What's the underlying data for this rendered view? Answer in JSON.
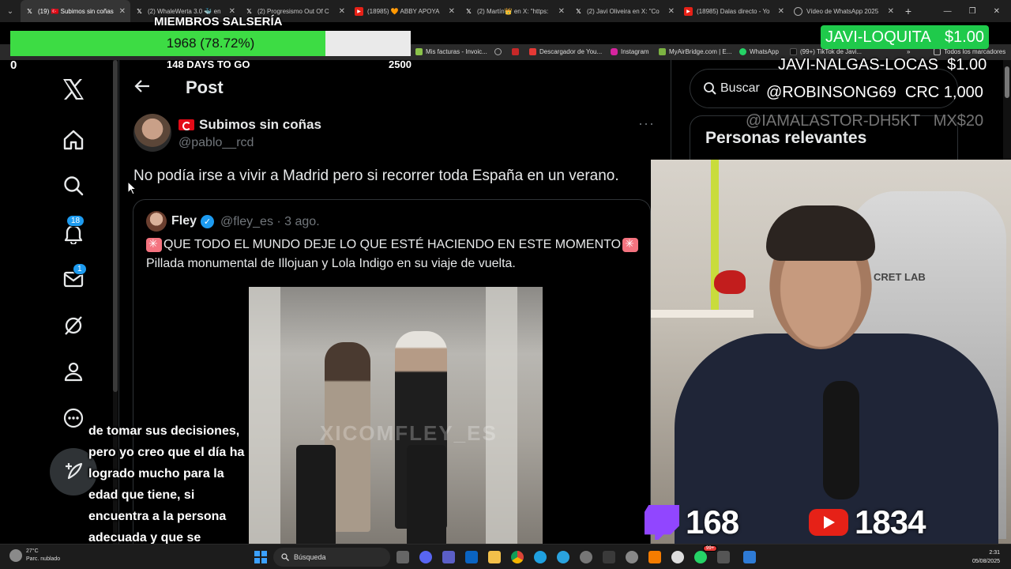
{
  "browser": {
    "tabs": [
      {
        "title": "(19) 🇹🇷 Subimos sin coñas",
        "icon": "x-logo-icon",
        "active": true
      },
      {
        "title": "(2) WhaleWerta 3.0 🐳 en",
        "icon": "x-logo-icon",
        "active": false
      },
      {
        "title": "(2) Progresismo Out Of C",
        "icon": "x-logo-icon",
        "active": false
      },
      {
        "title": "(18985) 🧡 ABBY APOYA",
        "icon": "youtube-icon",
        "active": false
      },
      {
        "title": "(2) Martín👑 en X: \"https:",
        "icon": "x-logo-icon",
        "active": false
      },
      {
        "title": "(2) Javi Oliveira en X: \"Co",
        "icon": "x-logo-icon",
        "active": false
      },
      {
        "title": "(18985) Dalas directo - Yo",
        "icon": "youtube-icon",
        "active": false
      },
      {
        "title": "Vídeo de WhatsApp 2025",
        "icon": "globe-icon",
        "active": false
      }
    ],
    "bookmarks": [
      "Mis facturas - Invoic...",
      "Descargador de You...",
      "Instagram",
      "MyAirBridge.com | E...",
      "WhatsApp",
      "(99+) TikTok de Javi..."
    ],
    "all_bookmarks": "Todos los marcadores"
  },
  "nav": {
    "notifications_badge": "18",
    "messages_badge": "1"
  },
  "post": {
    "header_title": "Post",
    "author_name": "Subimos sin coñas",
    "author_handle": "@pablo__rcd",
    "more": "···",
    "text": "No podía irse a vivir a Madrid pero si recorrer toda España en un verano.",
    "quote": {
      "name": "Fley",
      "handle_time": "@fley_es · 3 ago.",
      "line1": "QUE TODO EL MUNDO DEJE LO QUE ESTÉ HACIENDO EN ESTE MOMENTO",
      "line2": "Pillada monumental de Illojuan y Lola Indigo en su viaje de vuelta.",
      "video_watermark": "XICOMFLEY_ES"
    }
  },
  "sidebar": {
    "search_placeholder": "Buscar",
    "relevant_title": "Personas relevantes"
  },
  "overlay": {
    "goal_title": "MIEMBROS SALSERÍA",
    "goal_value": "1968 (78.72%)",
    "goal_fraction": 0.7872,
    "goal_min": "0",
    "goal_days": "148 DAYS TO GO",
    "goal_max": "2500",
    "tips": [
      {
        "name": "JAVI-LOQUITA",
        "amount": "$1.00"
      },
      {
        "name": "JAVI-NALGAS-LOCAS",
        "amount": "$1.00"
      },
      {
        "name": "@ROBINSONG69",
        "amount": "CRC 1,000"
      },
      {
        "name": "@IAMALASTOR-DH5KT",
        "amount": "MX$20"
      }
    ],
    "twitch_viewers": "168",
    "youtube_viewers": "1834",
    "caption": "de tomar sus decisiones, pero yo creo que el día ha logrado mucho para la edad que tiene, si encuentra a la persona adecuada y que se",
    "webcam_chair_text": "CRET LAB"
  },
  "taskbar": {
    "temperature": "27°C",
    "weather": "Parc. nublado",
    "search": "Búsqueda",
    "time": "2:31",
    "date": "05/08/2025",
    "whatsapp_badge": "99+"
  },
  "colors": {
    "accent": "#1d9bf0",
    "goal_fill": "#3ddc44",
    "tip_box": "#1fca4b",
    "twitch": "#9146ff",
    "youtube": "#e62117"
  }
}
